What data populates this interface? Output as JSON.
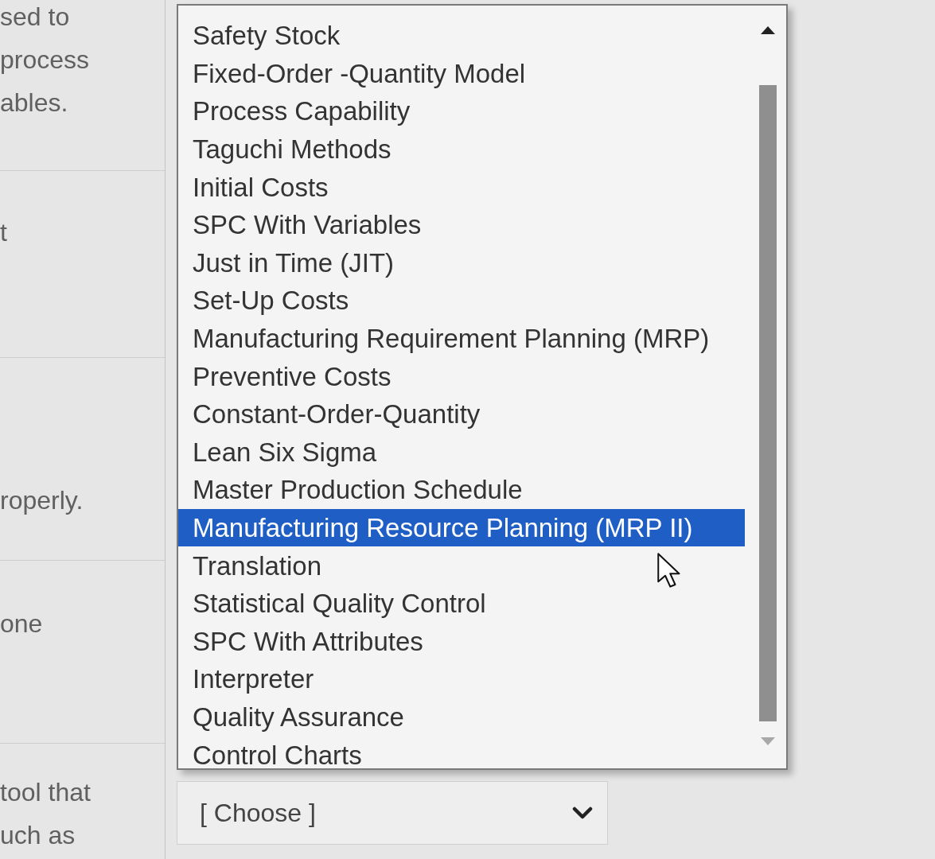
{
  "question_rows": [
    {
      "lines": [
        "sed to",
        "process",
        "ables."
      ]
    },
    {
      "lines": [
        "t"
      ]
    },
    {
      "lines": [
        "roperly."
      ]
    },
    {
      "lines": [
        "one"
      ]
    },
    {
      "lines": [
        "tool that",
        "uch as"
      ]
    }
  ],
  "dropdown_list": {
    "options": [
      {
        "label": "Safety Stock",
        "selected": false
      },
      {
        "label": "Fixed-Order -Quantity Model",
        "selected": false
      },
      {
        "label": "Process Capability",
        "selected": false
      },
      {
        "label": "Taguchi Methods",
        "selected": false
      },
      {
        "label": "Initial Costs",
        "selected": false
      },
      {
        "label": "SPC With Variables",
        "selected": false
      },
      {
        "label": "Just in Time (JIT)",
        "selected": false
      },
      {
        "label": "Set-Up Costs",
        "selected": false
      },
      {
        "label": "Manufacturing Requirement Planning (MRP)",
        "selected": false
      },
      {
        "label": "Preventive Costs",
        "selected": false
      },
      {
        "label": "Constant-Order-Quantity",
        "selected": false
      },
      {
        "label": "Lean Six Sigma",
        "selected": false
      },
      {
        "label": "Master Production Schedule",
        "selected": false
      },
      {
        "label": "Manufacturing Resource Planning (MRP II)",
        "selected": true
      },
      {
        "label": "Translation",
        "selected": false
      },
      {
        "label": "Statistical Quality Control",
        "selected": false
      },
      {
        "label": "SPC With Attributes",
        "selected": false
      },
      {
        "label": "Interpreter",
        "selected": false
      },
      {
        "label": "Quality Assurance",
        "selected": false
      },
      {
        "label": "Control Charts",
        "selected": false
      }
    ]
  },
  "select": {
    "value": "[ Choose ]"
  }
}
